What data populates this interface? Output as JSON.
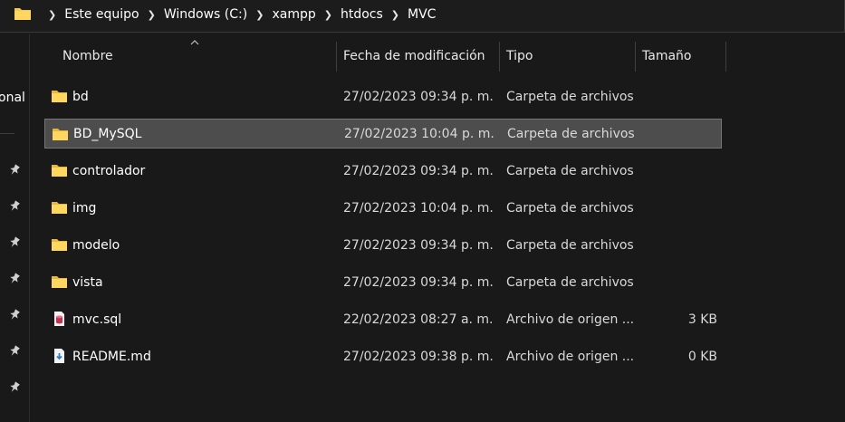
{
  "breadcrumb": [
    "Este equipo",
    "Windows (C:)",
    "xampp",
    "htdocs",
    "MVC"
  ],
  "nav": {
    "partial_label": "onal"
  },
  "columns": {
    "name": "Nombre",
    "date": "Fecha de modificación",
    "type": "Tipo",
    "size": "Tamaño"
  },
  "files": [
    {
      "name": "bd",
      "date": "27/02/2023 09:34 p. m.",
      "type": "Carpeta de archivos",
      "size": "",
      "icon": "folder-icon",
      "selected": false
    },
    {
      "name": "BD_MySQL",
      "date": "27/02/2023 10:04 p. m.",
      "type": "Carpeta de archivos",
      "size": "",
      "icon": "folder-icon",
      "selected": true
    },
    {
      "name": "controlador",
      "date": "27/02/2023 09:34 p. m.",
      "type": "Carpeta de archivos",
      "size": "",
      "icon": "folder-icon",
      "selected": false
    },
    {
      "name": "img",
      "date": "27/02/2023 10:04 p. m.",
      "type": "Carpeta de archivos",
      "size": "",
      "icon": "folder-icon",
      "selected": false
    },
    {
      "name": "modelo",
      "date": "27/02/2023 09:34 p. m.",
      "type": "Carpeta de archivos",
      "size": "",
      "icon": "folder-icon",
      "selected": false
    },
    {
      "name": "vista",
      "date": "27/02/2023 09:34 p. m.",
      "type": "Carpeta de archivos",
      "size": "",
      "icon": "folder-icon",
      "selected": false
    },
    {
      "name": "mvc.sql",
      "date": "22/02/2023 08:27 a. m.",
      "type": "Archivo de origen ...",
      "size": "3 KB",
      "icon": "sql-file-icon",
      "selected": false
    },
    {
      "name": "README.md",
      "date": "27/02/2023 09:38 p. m.",
      "type": "Archivo de origen ...",
      "size": "0 KB",
      "icon": "markdown-file-icon",
      "selected": false
    }
  ],
  "colors": {
    "folder": "#f8c93e",
    "selection": "#4d4d4d",
    "background": "#191919"
  }
}
